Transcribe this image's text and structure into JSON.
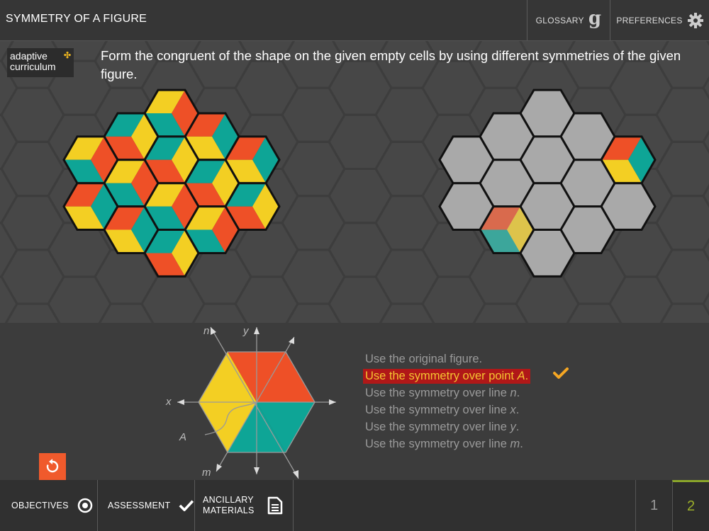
{
  "header": {
    "title": "SYMMETRY OF A FIGURE",
    "glossary_label": "GLOSSARY",
    "preferences_label": "PREFERENCES"
  },
  "logo": {
    "line1": "adaptive",
    "line2": "curriculum"
  },
  "instruction": "Form the congruent of the shape on the given empty cells by using different symmetries of the given figure.",
  "colors": {
    "red": "#ee5027",
    "yellow": "#f3cf23",
    "teal": "#0ea596",
    "gray_cell": "#a9a9a9",
    "active_bg": "#b01818",
    "active_text": "#f5c431",
    "accent": "#f05a2c"
  },
  "diagram": {
    "label_n": "n",
    "label_y": "y",
    "label_x": "x",
    "label_A": "A",
    "label_m": "m"
  },
  "options": [
    {
      "text": "Use the original figure.",
      "active": false
    },
    {
      "text": "Use the symmetry over point ",
      "italic": "A",
      "end": ".",
      "active": true
    },
    {
      "text": "Use the symmetry over line ",
      "italic": "n",
      "end": ".",
      "active": false
    },
    {
      "text": "Use the symmetry over line ",
      "italic": "x",
      "end": ".",
      "active": false
    },
    {
      "text": "Use the symmetry over line ",
      "italic": "y",
      "end": ".",
      "active": false
    },
    {
      "text": "Use the symmetry over line ",
      "italic": "m",
      "end": ".",
      "active": false
    }
  ],
  "footer": {
    "objectives": "OBJECTIVES",
    "assessment": "ASSESSMENT",
    "ancillary_line1": "ANCILLARY",
    "ancillary_line2": "MATERIALS",
    "pages": [
      "1",
      "2"
    ],
    "current_page": "2"
  },
  "icons": [
    "glossary-g-icon",
    "gear-icon",
    "target-icon",
    "checkmark-icon",
    "document-icon",
    "reset-icon",
    "check-icon"
  ]
}
